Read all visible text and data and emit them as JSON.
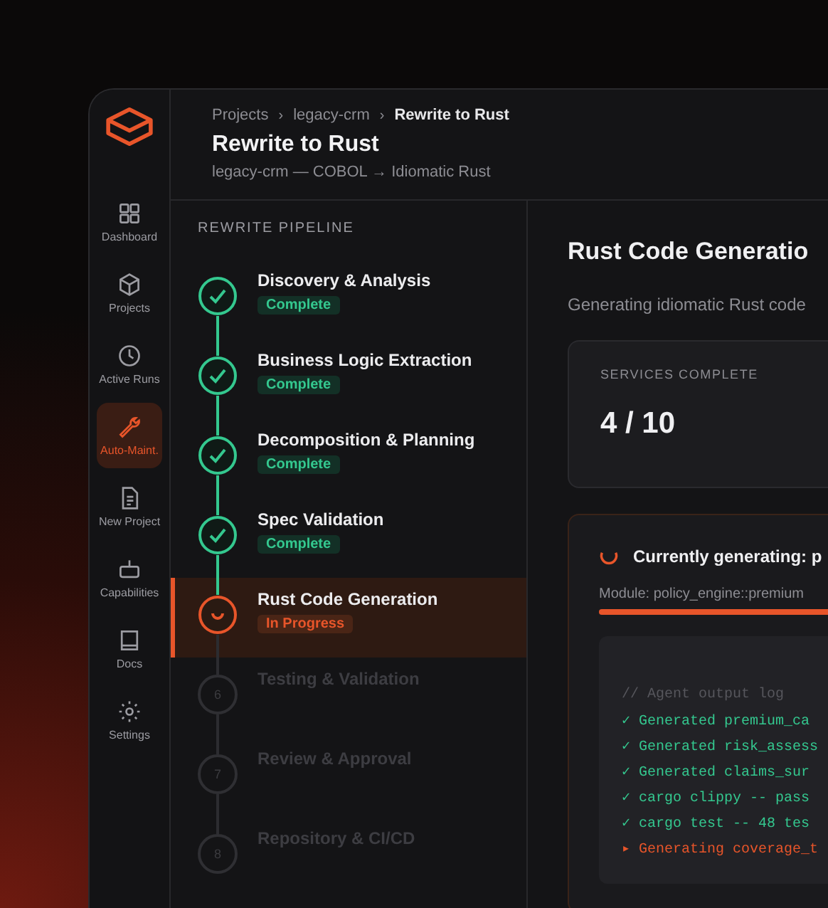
{
  "sidebar": {
    "items": [
      {
        "label": "Dashboard",
        "selected": false
      },
      {
        "label": "Projects",
        "selected": false
      },
      {
        "label": "Active Runs",
        "selected": false
      },
      {
        "label": "Auto-Maint.",
        "selected": true
      },
      {
        "label": "New Project",
        "selected": false
      },
      {
        "label": "Capabilities",
        "selected": false
      },
      {
        "label": "Docs",
        "selected": false
      },
      {
        "label": "Settings",
        "selected": false
      }
    ]
  },
  "breadcrumb": [
    "Projects",
    "legacy-crm",
    "Rewrite to Rust"
  ],
  "breadcrumb_separator": "›",
  "title": "Rewrite to Rust",
  "subtitle": "legacy-crm — COBOL → Idiomatic Rust",
  "pipeline": {
    "heading": "REWRITE PIPELINE",
    "steps": [
      {
        "kind": "complete",
        "name": "Discovery & Analysis",
        "status": "Complete",
        "selected": false
      },
      {
        "kind": "complete",
        "name": "Business Logic Extraction",
        "status": "Complete",
        "selected": false
      },
      {
        "kind": "complete",
        "name": "Decomposition & Planning",
        "status": "Complete",
        "selected": false
      },
      {
        "kind": "complete",
        "name": "Spec Validation",
        "status": "Complete",
        "selected": false
      },
      {
        "kind": "progress",
        "name": "Rust Code Generation",
        "status": "In Progress",
        "selected": true
      },
      {
        "kind": "pending",
        "number": "6",
        "name": "Testing & Validation",
        "selected": false
      },
      {
        "kind": "pending",
        "number": "7",
        "name": "Review & Approval",
        "selected": false
      },
      {
        "kind": "pending",
        "number": "8",
        "name": "Repository & CI/CD",
        "selected": false
      }
    ]
  },
  "detail": {
    "title": "Rust Code Generatio",
    "description": "Generating idiomatic Rust code",
    "stat": {
      "label": "SERVICES COMPLETE",
      "value": "4 / 10"
    },
    "current": {
      "heading": "Currently generating: p",
      "module": "Module: policy_engine::premium",
      "level": 1,
      "log": [
        {
          "kind": "comment",
          "text": "// Agent output log"
        },
        {
          "kind": "done",
          "mark": "✓",
          "text": "Generated premium_ca"
        },
        {
          "kind": "done",
          "mark": "✓",
          "text": "Generated risk_assess"
        },
        {
          "kind": "done",
          "mark": "✓",
          "text": "Generated claims_sur"
        },
        {
          "kind": "done",
          "mark": "✓",
          "text": "cargo clippy -- pass"
        },
        {
          "kind": "done",
          "mark": "✓",
          "text": "cargo test -- 48 tes"
        },
        {
          "kind": "running",
          "mark": "▸",
          "text": "Generating coverage_t"
        }
      ]
    }
  }
}
